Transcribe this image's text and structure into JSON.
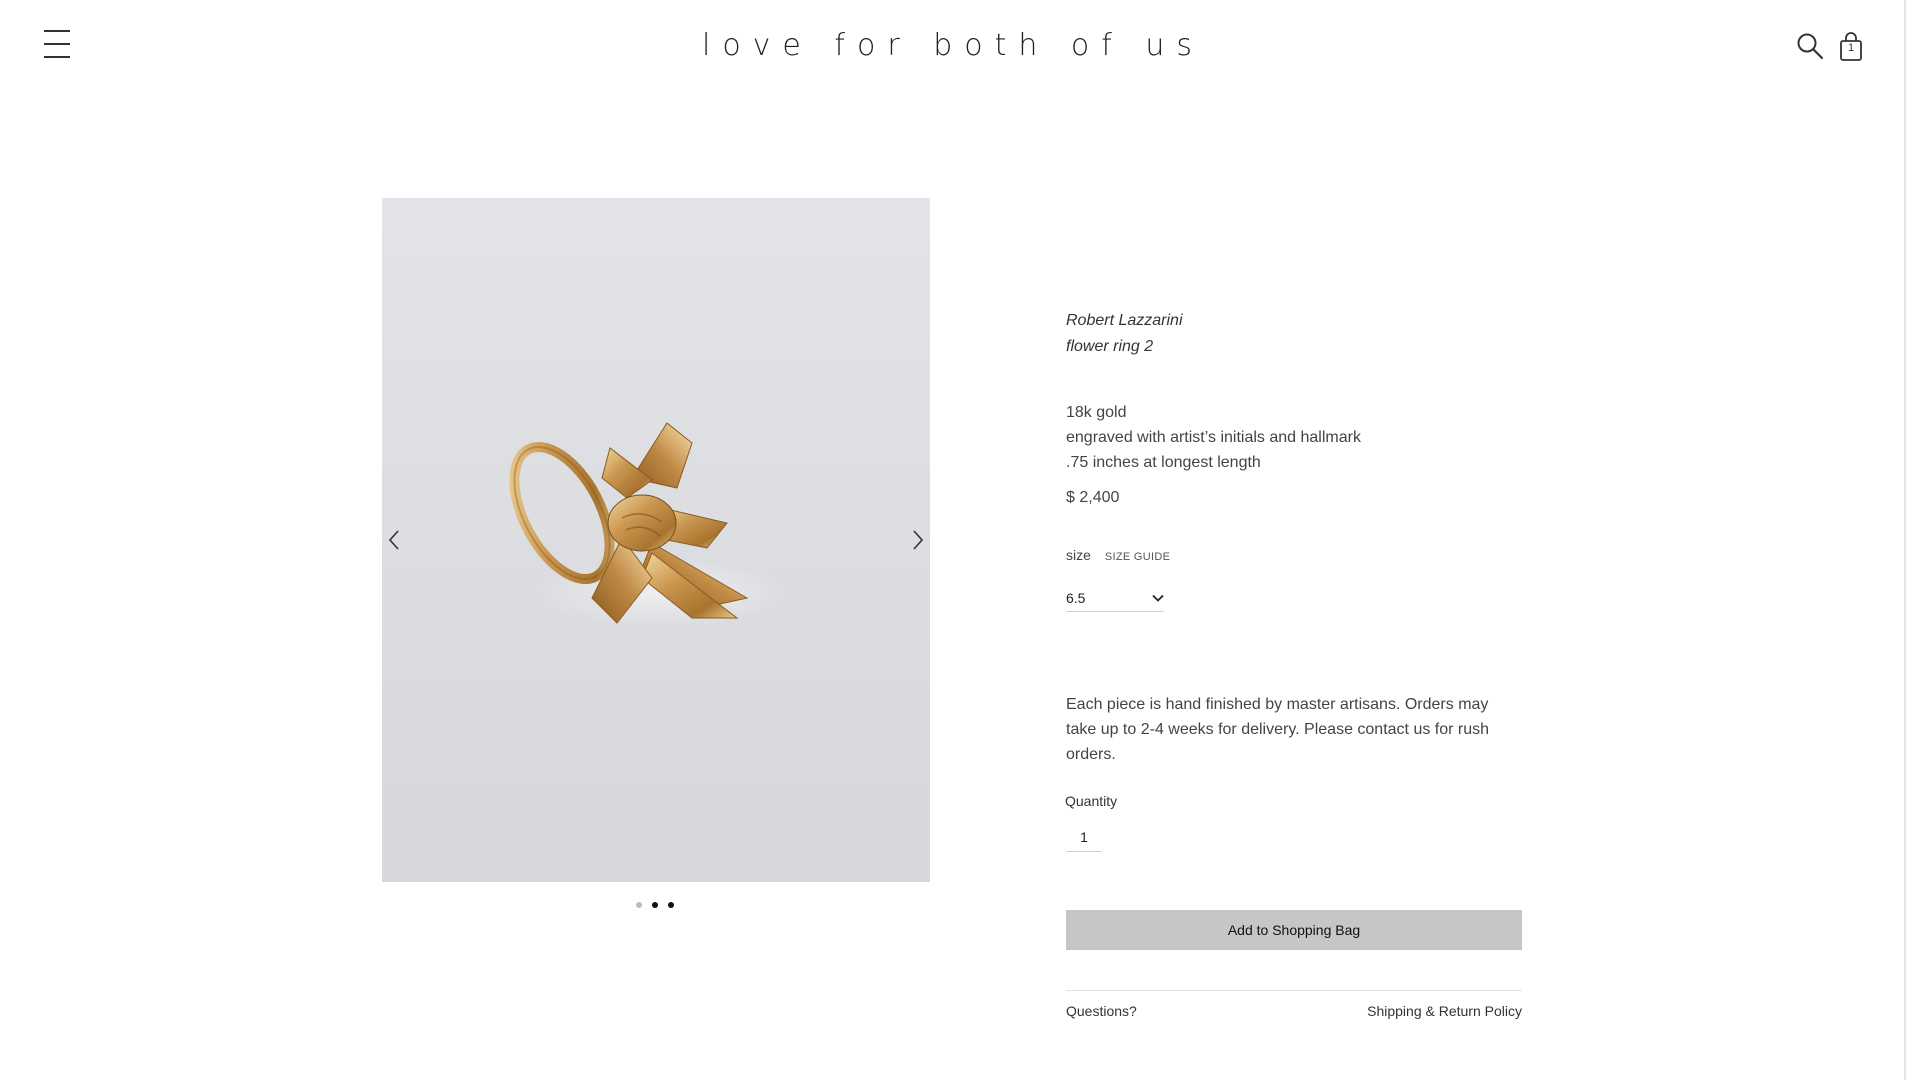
{
  "header": {
    "logo": "love for both of us",
    "menu_icon": "hamburger-menu-icon",
    "search_icon": "search-icon",
    "bag_icon": "shopping-bag-icon",
    "bag_count": "1"
  },
  "gallery": {
    "image_subject": "gold flower ring",
    "prev_icon": "chevron-left-icon",
    "next_icon": "chevron-right-icon",
    "slide_count": 3,
    "active_slide": 1,
    "background_color": "#dcdee1"
  },
  "product": {
    "artist": "Robert Lazzarini",
    "name": "flower ring 2",
    "specs": [
      "18k gold",
      "engraved with artist’s initials and hallmark",
      ".75 inches at longest length"
    ],
    "price": "$ 2,400",
    "size_label": "size",
    "size_guide_label": "SIZE GUIDE",
    "size_value": "6.5",
    "note": "Each piece is hand finished by master artisans. Orders may take up to 2-4 weeks for delivery. Please contact us for rush orders.",
    "quantity_label": "Quantity",
    "quantity_value": "1",
    "add_to_bag_label": "Add to Shopping Bag",
    "questions_label": "Questions?",
    "shipping_label": "Shipping & Return Policy"
  },
  "colors": {
    "button_bg": "#c6c6c6",
    "text": "#333333"
  }
}
